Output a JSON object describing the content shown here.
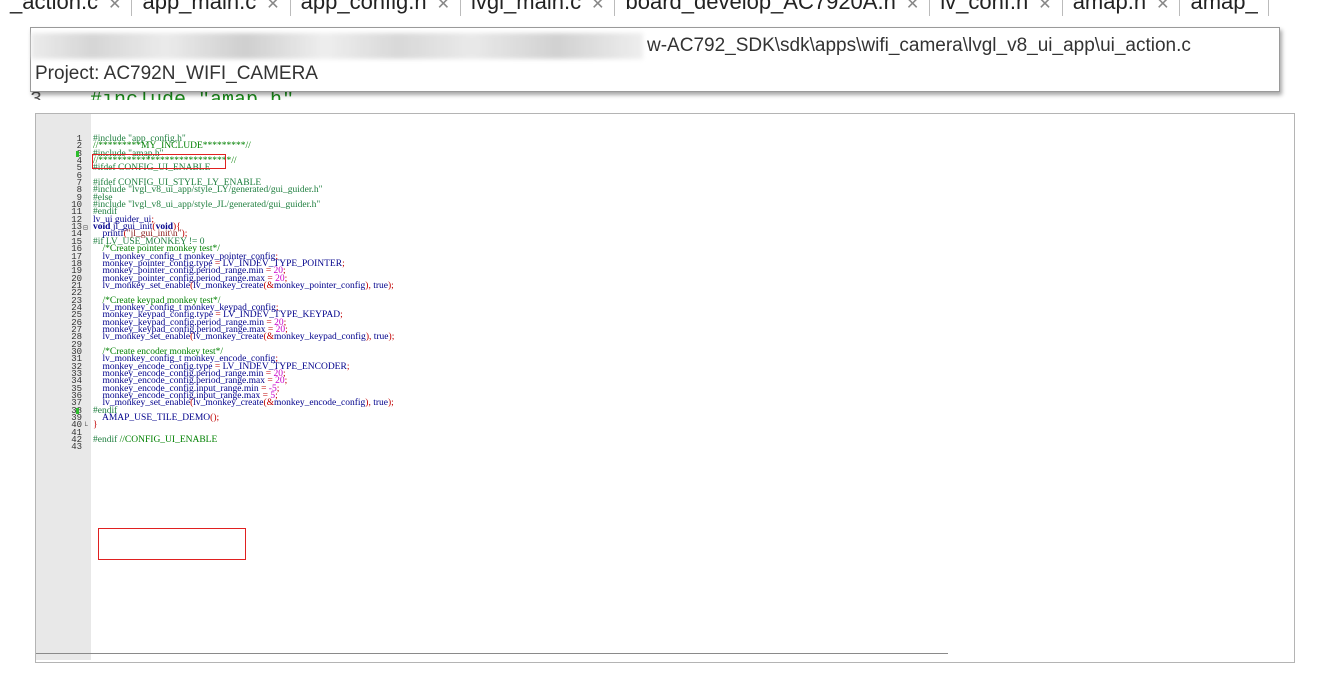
{
  "tabs": [
    {
      "label": "_action.c"
    },
    {
      "label": "app_main.c"
    },
    {
      "label": "app_config.h"
    },
    {
      "label": "lvgl_main.c"
    },
    {
      "label": "board_develop_AC7920A.h"
    },
    {
      "label": "lv_conf.h"
    },
    {
      "label": "amap.h"
    },
    {
      "label": "amap_"
    }
  ],
  "tooltip": {
    "path_suffix": "w-AC792_SDK\\sdk\\apps\\wifi_camera\\lvgl_v8_ui_app\\ui_action.c",
    "project": "Project: AC792N_WIFI_CAMERA"
  },
  "peek": {
    "line_number": "3",
    "text": "#include \"amap.h\""
  },
  "editor": {
    "line_numbers": [
      "1",
      "2",
      "3",
      "4",
      "5",
      "6",
      "7",
      "8",
      "9",
      "10",
      "11",
      "12",
      "13",
      "14",
      "15",
      "16",
      "17",
      "18",
      "19",
      "20",
      "21",
      "22",
      "23",
      "24",
      "25",
      "26",
      "27",
      "28",
      "29",
      "30",
      "31",
      "32",
      "33",
      "34",
      "35",
      "36",
      "37",
      "38",
      "39",
      "40",
      "41",
      "42",
      "43"
    ],
    "lines": [
      "#include \"app_config.h\"",
      "//*********MY_INCLUDE*********//",
      "#include \"amap.h\"",
      "//****************************//",
      "#ifdef CONFIG_UI_ENABLE",
      "",
      "#ifdef CONFIG_UI_STYLE_LY_ENABLE",
      "#include \"lvgl_v8_ui_app/style_LY/generated/gui_guider.h\"",
      "#else",
      "#include \"lvgl_v8_ui_app/style_JL/generated/gui_guider.h\"",
      "#endif",
      "lv_ui guider_ui;",
      "void jl_gui_init(void){",
      "    printf(\"jl_gui_init\\n\");",
      "#if LV_USE_MONKEY != 0",
      "    /*Create pointer monkey test*/",
      "    lv_monkey_config_t monkey_pointer_config;",
      "    monkey_pointer_config.type = LV_INDEV_TYPE_POINTER;",
      "    monkey_pointer_config.period_range.min = 20;",
      "    monkey_pointer_config.period_range.max = 20;",
      "    lv_monkey_set_enable(lv_monkey_create(&monkey_pointer_config), true);",
      "",
      "    /*Create keypad monkey test*/",
      "    lv_monkey_config_t monkey_keypad_config;",
      "    monkey_keypad_config.type = LV_INDEV_TYPE_KEYPAD;",
      "    monkey_keypad_config.period_range.min = 20;",
      "    monkey_keypad_config.period_range.max = 20;",
      "    lv_monkey_set_enable(lv_monkey_create(&monkey_keypad_config), true);",
      "",
      "    /*Create encoder monkey test*/",
      "    lv_monkey_config_t monkey_encode_config;",
      "    monkey_encode_config.type = LV_INDEV_TYPE_ENCODER;",
      "    monkey_encode_config.period_range.min = 20;",
      "    monkey_encode_config.period_range.max = 20;",
      "    monkey_encode_config.input_range.min = -5;",
      "    monkey_encode_config.input_range.max = 5;",
      "    lv_monkey_set_enable(lv_monkey_create(&monkey_encode_config), true);",
      "#endif",
      "    AMAP_USE_TILE_DEMO();",
      "}",
      "",
      "#endif //CONFIG_UI_ENABLE",
      ""
    ],
    "changed_lines": [
      3,
      38
    ],
    "fold_markers": [
      {
        "line": 13,
        "glyph": "⊟"
      },
      {
        "line": 40,
        "glyph": "└"
      }
    ]
  },
  "colors": {
    "highlight_box": "#e02020",
    "change_marker": "#2ebd2e",
    "gutter": "#e8e8e8"
  }
}
